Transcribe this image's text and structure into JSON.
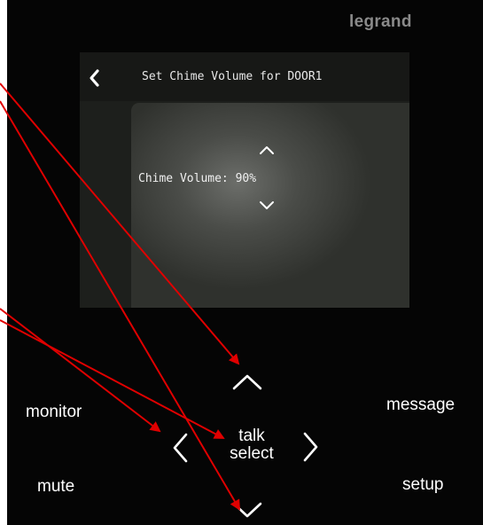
{
  "device": {
    "brand": "legrand"
  },
  "screen": {
    "title": "Set Chime Volume for DOOR1",
    "back_icon": "chevron-left-icon",
    "volume_label": "Chime Volume: 90%",
    "volume_percent": 90,
    "up_icon": "chevron-up-icon",
    "down_icon": "chevron-down-icon"
  },
  "buttons": {
    "monitor": "monitor",
    "message": "message",
    "mute": "mute",
    "setup": "setup",
    "talk": "talk",
    "select": "select"
  },
  "colors": {
    "panel": "#050505",
    "brand_text": "#8a8a8a",
    "annotation_arrow": "#e00000"
  }
}
